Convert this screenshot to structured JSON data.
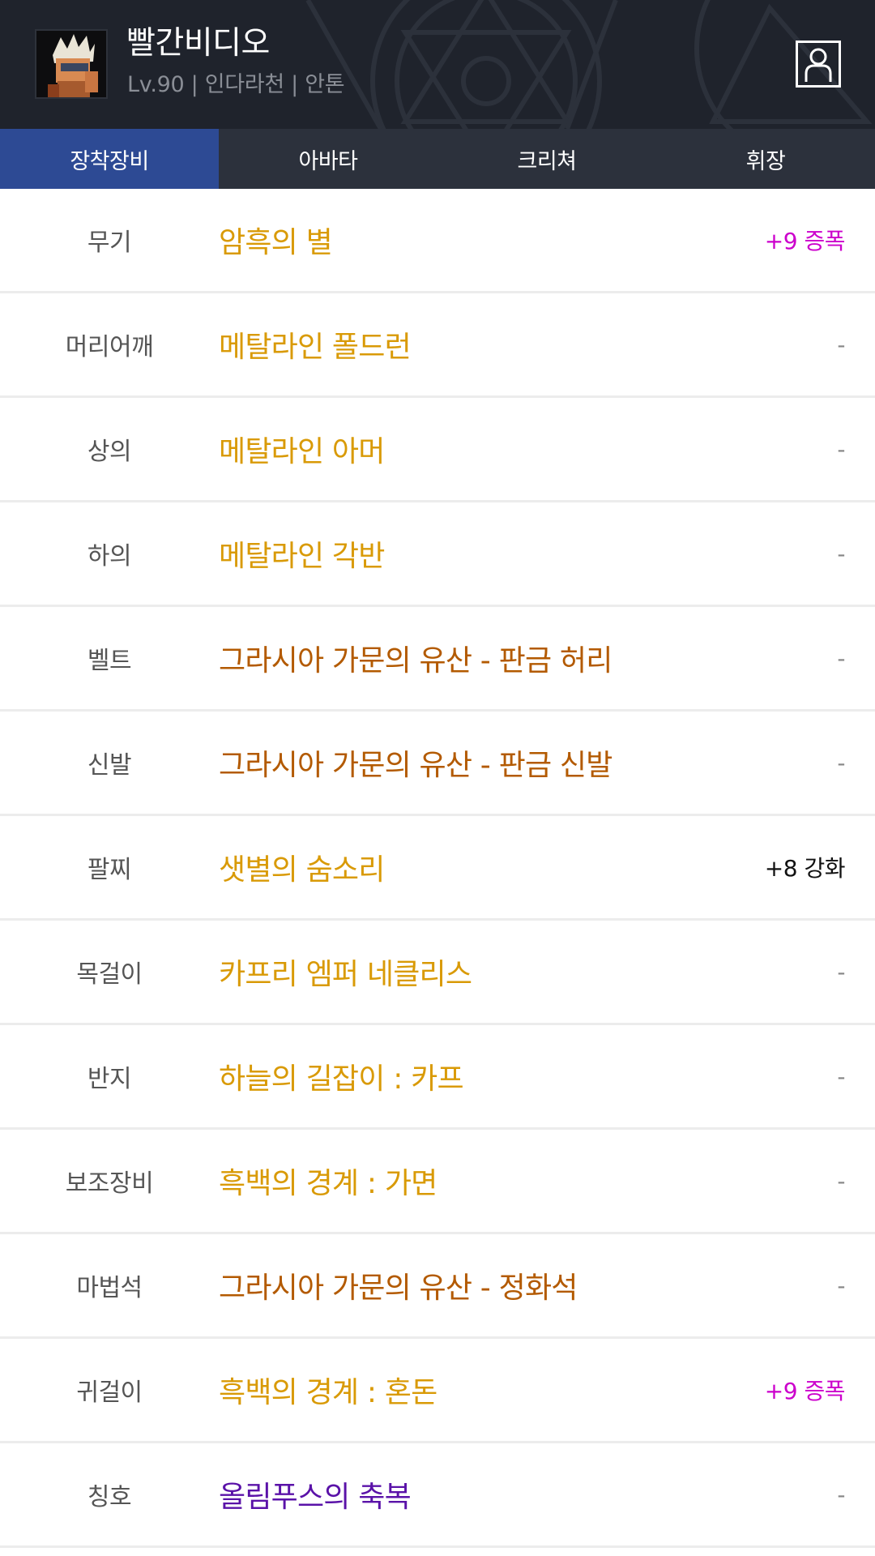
{
  "character": {
    "name": "빨간비디오",
    "meta": "Lv.90 | 인다라천 | 안톤"
  },
  "icons": {
    "profile": "person-outline-icon",
    "avatar": "character-portrait"
  },
  "tabs": [
    {
      "label": "장착장비",
      "active": true
    },
    {
      "label": "아바타",
      "active": false
    },
    {
      "label": "크리쳐",
      "active": false
    },
    {
      "label": "휘장",
      "active": false
    }
  ],
  "colors": {
    "header_bg": "#1f232c",
    "tab_bar": "#2c313c",
    "tab_active": "#2d4a94",
    "epic": "#e0a100",
    "legendary": "#b35f00",
    "unique": "#5a12a8",
    "amplify": "#cc00cc",
    "enhance": "#111111",
    "none": "#888888"
  },
  "equipment": [
    {
      "slot": "무기",
      "item": "암흑의 별",
      "item_color": "#d99a06",
      "extra": "+9 증폭",
      "extra_color": "#cc00cc"
    },
    {
      "slot": "머리어깨",
      "item": "메탈라인 폴드런",
      "item_color": "#d99a06",
      "extra": "-",
      "extra_color": "#888888"
    },
    {
      "slot": "상의",
      "item": "메탈라인 아머",
      "item_color": "#d99a06",
      "extra": "-",
      "extra_color": "#888888"
    },
    {
      "slot": "하의",
      "item": "메탈라인 각반",
      "item_color": "#d99a06",
      "extra": "-",
      "extra_color": "#888888"
    },
    {
      "slot": "벨트",
      "item": "그라시아 가문의 유산 - 판금 허리",
      "item_color": "#b35a00",
      "extra": "-",
      "extra_color": "#888888"
    },
    {
      "slot": "신발",
      "item": "그라시아 가문의 유산 - 판금 신발",
      "item_color": "#b35a00",
      "extra": "-",
      "extra_color": "#888888"
    },
    {
      "slot": "팔찌",
      "item": "샛별의 숨소리",
      "item_color": "#d99a06",
      "extra": "+8 강화",
      "extra_color": "#111111"
    },
    {
      "slot": "목걸이",
      "item": "카프리 엠퍼 네클리스",
      "item_color": "#d99a06",
      "extra": "-",
      "extra_color": "#888888"
    },
    {
      "slot": "반지",
      "item": "하늘의 길잡이 : 카프",
      "item_color": "#d99a06",
      "extra": "-",
      "extra_color": "#888888"
    },
    {
      "slot": "보조장비",
      "item": "흑백의 경계 : 가면",
      "item_color": "#d99a06",
      "extra": "-",
      "extra_color": "#888888"
    },
    {
      "slot": "마법석",
      "item": "그라시아 가문의 유산 - 정화석",
      "item_color": "#b35a00",
      "extra": "-",
      "extra_color": "#888888"
    },
    {
      "slot": "귀걸이",
      "item": "흑백의 경계 : 혼돈",
      "item_color": "#d99a06",
      "extra": "+9 증폭",
      "extra_color": "#cc00cc"
    },
    {
      "slot": "칭호",
      "item": "올림푸스의 축복",
      "item_color": "#5a12a8",
      "extra": "-",
      "extra_color": "#888888"
    }
  ]
}
